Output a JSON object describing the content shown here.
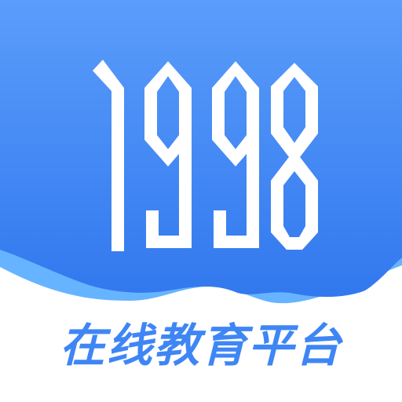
{
  "logo": {
    "number": "1998",
    "colors": {
      "background_top": "#5a9dfb",
      "background_bottom": "#3278ee",
      "wave_light": "#66b4ff",
      "number_fill": "#ffffff",
      "slogan": "#3f86f5"
    }
  },
  "slogan": "在线教育平台"
}
